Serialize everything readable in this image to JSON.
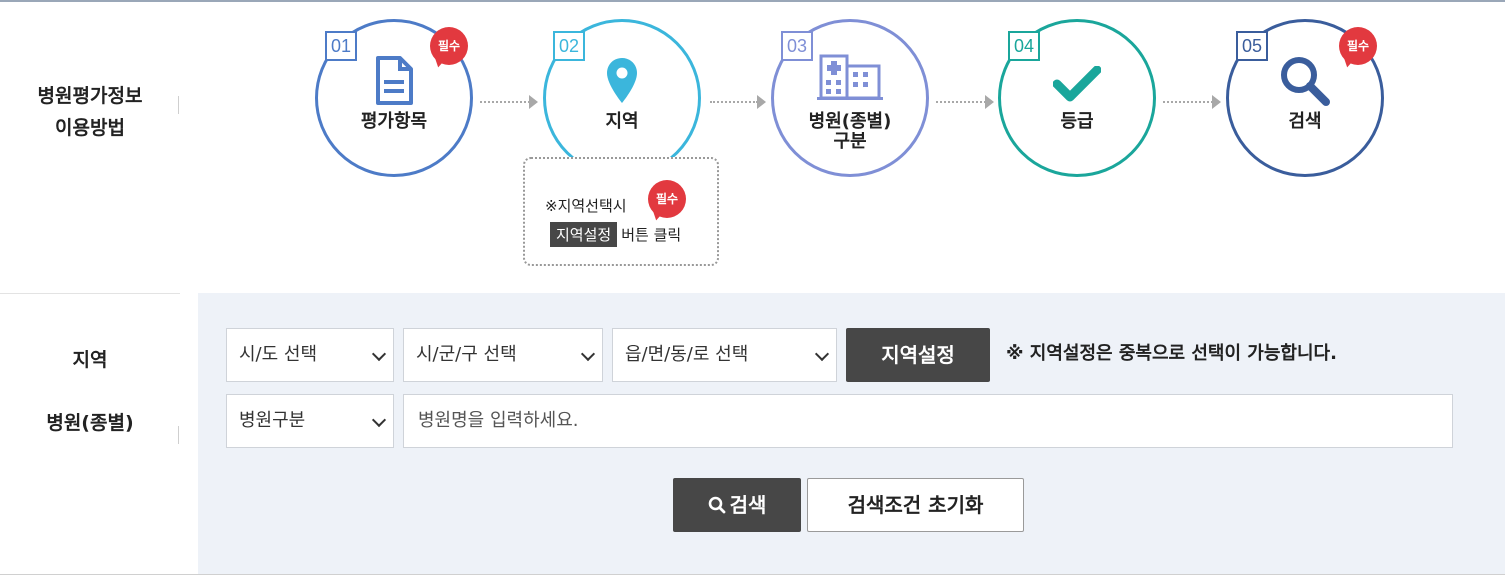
{
  "guide": {
    "title_line1": "병원평가정보",
    "title_line2": "이용방법",
    "required_badge": "필수",
    "steps": [
      {
        "num": "01",
        "label": "평가항목",
        "icon": "document-icon",
        "color": "#4d7bc7"
      },
      {
        "num": "02",
        "label": "지역",
        "icon": "location-pin-icon",
        "color": "#3bb6dc"
      },
      {
        "num": "03",
        "label_line1": "병원(종별)",
        "label_line2": "구분",
        "icon": "building-icon",
        "color": "#7f8fd6"
      },
      {
        "num": "04",
        "label": "등급",
        "icon": "check-icon",
        "color": "#1aa69b"
      },
      {
        "num": "05",
        "label": "검색",
        "icon": "search-icon",
        "color": "#3a5d9c"
      }
    ],
    "note": {
      "line1": "※지역선택시",
      "tag": "지역설정",
      "line2_rest": "버튼 클릭"
    }
  },
  "search": {
    "region_label": "지역",
    "hospital_label": "병원(종별)",
    "sido_select": "시/도 선택",
    "sigungu_select": "시/군/구 선택",
    "eup_select": "읍/면/동/로 선택",
    "region_button": "지역설정",
    "region_hint": "※ 지역설정은 중복으로 선택이 가능합니다.",
    "hospital_type_select": "병원구분",
    "hospital_name_placeholder": "병원명을 입력하세요.",
    "search_button": "검색",
    "reset_button": "검색조건 초기화"
  }
}
